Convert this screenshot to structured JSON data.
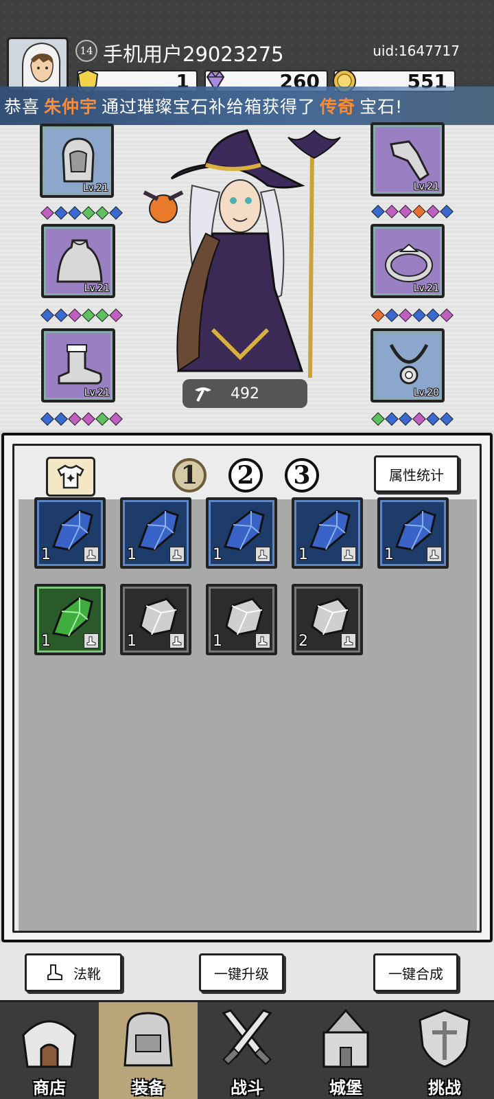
{
  "header": {
    "level": "14",
    "username": "手机用户29023275",
    "uid": "uid:1647717",
    "currencies": [
      {
        "name": "gold-shield-icon",
        "value": "1"
      },
      {
        "name": "purple-gem-icon",
        "value": "260"
      },
      {
        "name": "gold-coin-icon",
        "value": "551"
      }
    ]
  },
  "banner": {
    "prefix": "恭喜",
    "player": "朱仲宇",
    "middle": "通过璀璨宝石补给箱获得了",
    "rarity": "传奇",
    "suffix": "宝石!"
  },
  "equipment": {
    "left": [
      {
        "slot": "hood",
        "level": "Lv.21",
        "color": "blue"
      },
      {
        "slot": "cloak",
        "level": "Lv.21",
        "color": "purple"
      },
      {
        "slot": "boots",
        "level": "Lv.21",
        "color": "purple"
      }
    ],
    "right": [
      {
        "slot": "gloves",
        "level": "Lv.21",
        "color": "purple"
      },
      {
        "slot": "ring",
        "level": "Lv.21",
        "color": "purple"
      },
      {
        "slot": "necklace",
        "level": "Lv.20",
        "color": "blue"
      }
    ],
    "power": "492"
  },
  "inventory": {
    "pages": [
      "1",
      "2",
      "3"
    ],
    "active_page": "1",
    "stats_button": "属性统计",
    "items": [
      {
        "type": "blue-crystal",
        "count": "1"
      },
      {
        "type": "blue-crystal",
        "count": "1"
      },
      {
        "type": "blue-crystal",
        "count": "1"
      },
      {
        "type": "blue-crystal",
        "count": "1"
      },
      {
        "type": "blue-crystal",
        "count": "1"
      },
      {
        "type": "green-crystal",
        "count": "1"
      },
      {
        "type": "gray-stone",
        "count": "1"
      },
      {
        "type": "gray-stone",
        "count": "1"
      },
      {
        "type": "gray-stone",
        "count": "2"
      }
    ]
  },
  "actions": {
    "filter_label": "法靴",
    "upgrade_all": "一键升级",
    "merge_all": "一键合成"
  },
  "nav": {
    "items": [
      {
        "label": "商店"
      },
      {
        "label": "装备"
      },
      {
        "label": "战斗"
      },
      {
        "label": "城堡"
      },
      {
        "label": "挑战"
      }
    ],
    "active": "装备"
  }
}
